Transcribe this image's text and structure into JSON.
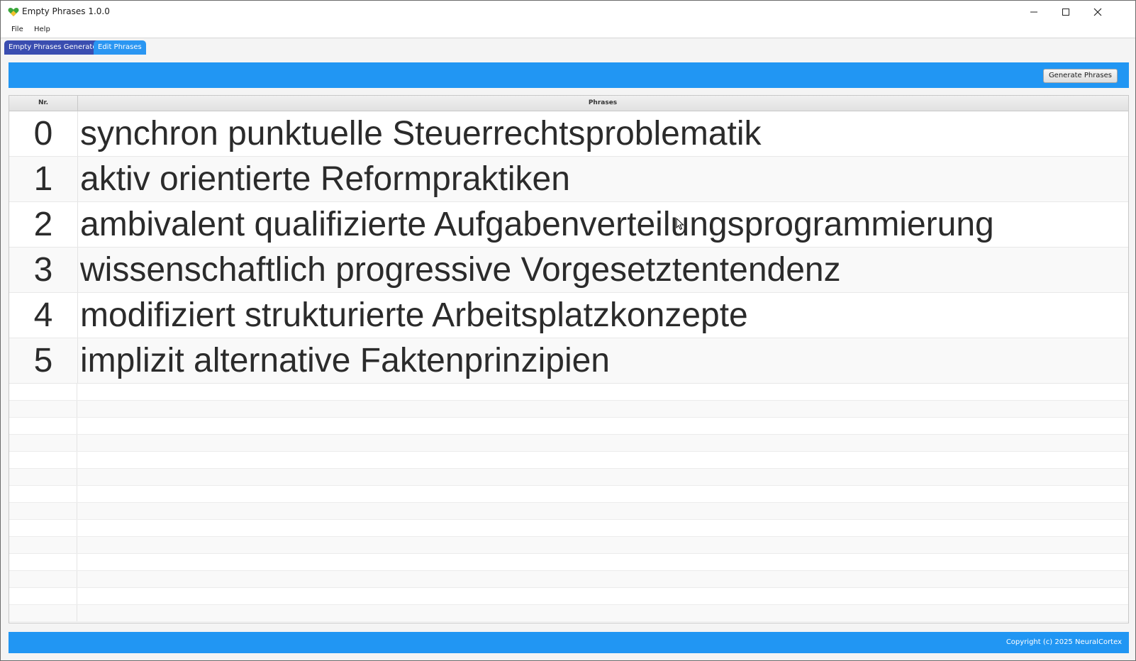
{
  "window": {
    "title": "Empty Phrases 1.0.0",
    "icon": "green-heart-icon"
  },
  "menu": {
    "items": [
      "File",
      "Help"
    ]
  },
  "tabs": [
    {
      "label": "Empty Phrases Generator",
      "active": true
    },
    {
      "label": "Edit Phrases",
      "active": false
    }
  ],
  "toolbar": {
    "generate_label": "Generate Phrases"
  },
  "table": {
    "columns": [
      "Nr.",
      "Phrases"
    ],
    "rows": [
      {
        "nr": "0",
        "phrase": "synchron punktuelle Steuerrechtsproblematik"
      },
      {
        "nr": "1",
        "phrase": "aktiv orientierte Reformpraktiken"
      },
      {
        "nr": "2",
        "phrase": "ambivalent qualifizierte Aufgabenverteilungsprogrammierung"
      },
      {
        "nr": "3",
        "phrase": "wissenschaftlich progressive Vorgesetztentendenz"
      },
      {
        "nr": "4",
        "phrase": "modifiziert strukturierte Arbeitsplatzkonzepte"
      },
      {
        "nr": "5",
        "phrase": "implizit alternative Faktenprinzipien"
      }
    ]
  },
  "footer": {
    "copyright": "Copyright (c) 2025 NeuralCortex"
  },
  "colors": {
    "accent": "#2196f3",
    "tab_active": "#3a4db0",
    "tab_inactive": "#2a96f2"
  }
}
